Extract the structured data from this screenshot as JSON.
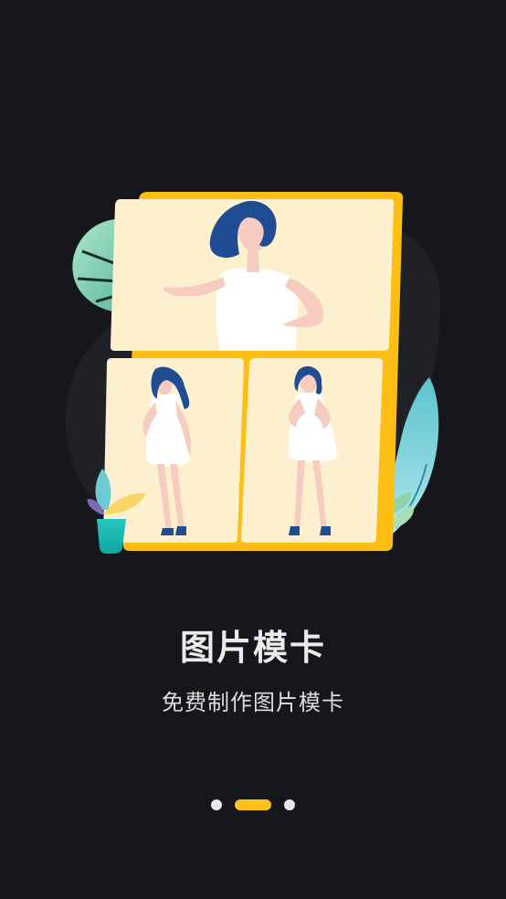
{
  "onboarding": {
    "title": "图片模卡",
    "subtitle": "免费制作图片模卡",
    "page_indicator": {
      "total": 3,
      "active_index": 1
    }
  },
  "colors": {
    "background": "#16171b",
    "accent": "#ffc21a",
    "card_fill": "#fdf0cf",
    "frame_border": "#ffbe14",
    "hair": "#1f4c93",
    "skin": "#f6cbc0",
    "dress": "#ffffff"
  },
  "icons": {
    "illustration": "photo-model-card-illustration"
  }
}
